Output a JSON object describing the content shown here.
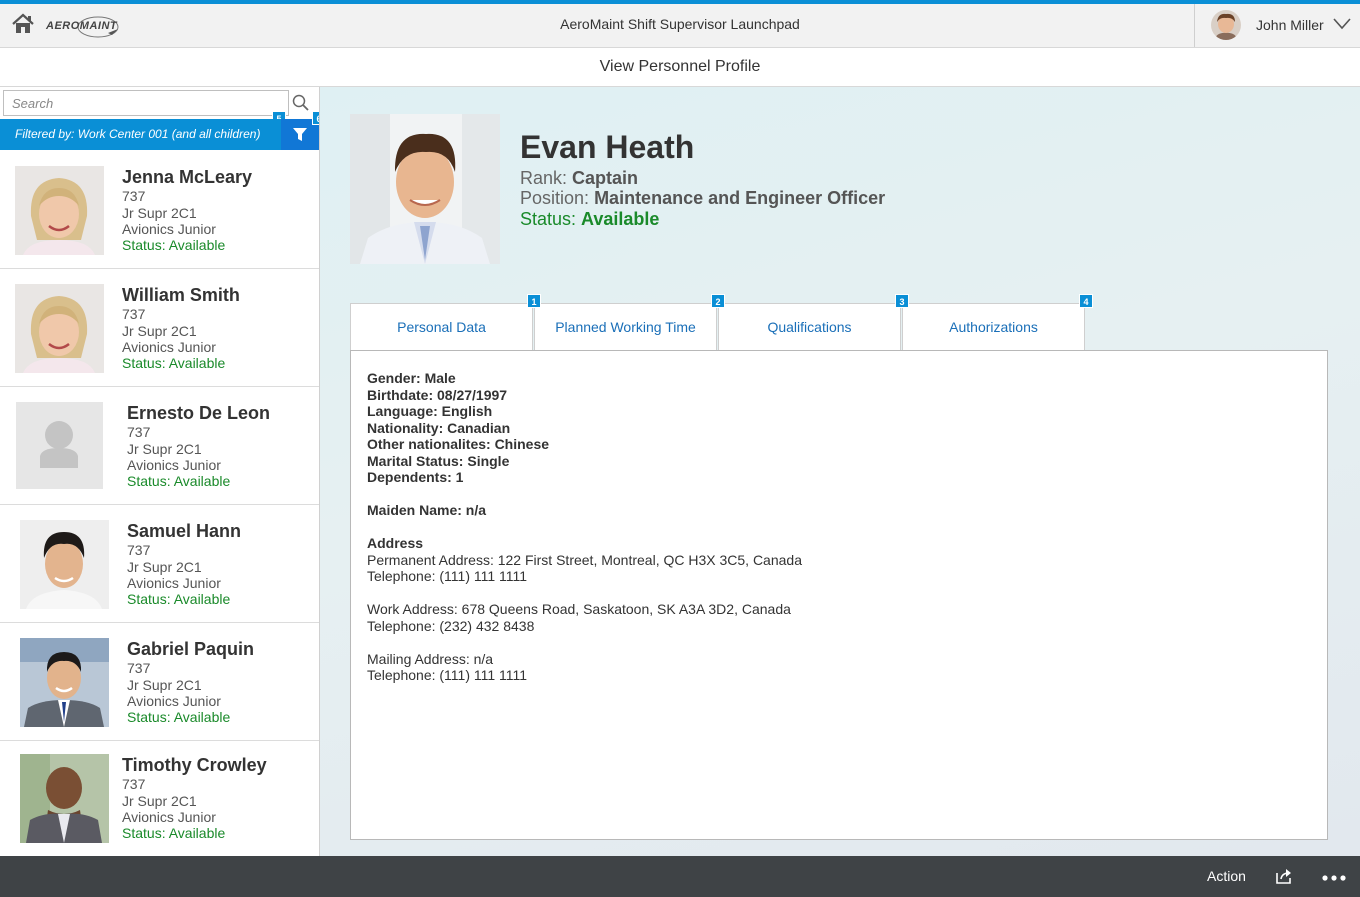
{
  "shell": {
    "home_icon": "home-icon",
    "logo_text": "AEROMAINT",
    "app_title": "AeroMaint Shift Supervisor Launchpad",
    "user_name": "John Miller",
    "menu_icon": "chevron-down-icon"
  },
  "page": {
    "title": "View Personnel Profile"
  },
  "master": {
    "search_placeholder": "Search",
    "filter_text": "Filtered by: Work Center 001 (and all children)",
    "badges": {
      "search": "5",
      "filter": "6"
    },
    "items": [
      {
        "name": "Jenna McLeary",
        "code": "737",
        "role": "Jr Supr 2C1",
        "dept": "Avionics Junior",
        "status": "Status: Available",
        "photo": "female-photo"
      },
      {
        "name": "William Smith",
        "code": "737",
        "role": "Jr Supr 2C1",
        "dept": "Avionics Junior",
        "status": "Status: Available",
        "photo": "female-photo"
      },
      {
        "name": "Ernesto De Leon",
        "code": "737",
        "role": "Jr Supr 2C1",
        "dept": "Avionics Junior",
        "status": "Status: Available",
        "photo": "placeholder-person"
      },
      {
        "name": "Samuel Hann",
        "code": "737",
        "role": "Jr Supr 2C1",
        "dept": "Avionics Junior",
        "status": "Status: Available",
        "photo": "male-photo"
      },
      {
        "name": "Gabriel Paquin",
        "code": "737",
        "role": "Jr Supr 2C1",
        "dept": "Avionics Junior",
        "status": "Status: Available",
        "photo": "male-photo"
      },
      {
        "name": "Timothy Crowley",
        "code": "737",
        "role": "Jr Supr 2C1",
        "dept": "Avionics Junior",
        "status": "Status: Available",
        "photo": "male-photo"
      }
    ]
  },
  "profile": {
    "name": "Evan Heath",
    "rank_label": "Rank:",
    "rank": "Captain",
    "position_label": "Position:",
    "position": "Maintenance and Engineer Officer",
    "status_label": "Status:",
    "status": "Available"
  },
  "tabs": [
    {
      "label": "Personal Data",
      "badge": "1"
    },
    {
      "label": "Planned Working Time",
      "badge": "2"
    },
    {
      "label": "Qualifications",
      "badge": "3"
    },
    {
      "label": "Authorizations",
      "badge": "4"
    }
  ],
  "personal": {
    "gender": "Gender: Male",
    "birthdate": "Birthdate: 08/27/1997",
    "language": "Language: English",
    "nationality": "Nationality: Canadian",
    "other_nationalities": "Other nationalites: Chinese",
    "marital": "Marital Status: Single",
    "dependents": "Dependents: 1",
    "maiden": "Maiden Name: n/a",
    "address_heading": "Address",
    "permanent": "Permanent Address: 122 First Street, Montreal, QC H3X 3C5, Canada",
    "permanent_phone": "Telephone: (111) 111 1111",
    "work": "Work Address: 678 Queens Road, Saskatoon, SK A3A 3D2, Canada",
    "work_phone": "Telephone: (232) 432 8438",
    "mailing": "Mailing Address: n/a",
    "mailing_phone": "Telephone: (111) 111 1111"
  },
  "footer": {
    "action_label": "Action",
    "share_icon": "share-icon",
    "more_icon": "more-icon"
  },
  "colors": {
    "accent": "#0a8fd6",
    "filter_button": "#1177d6",
    "status_green": "#1a8a2a",
    "footer_bg": "#3f4346"
  }
}
